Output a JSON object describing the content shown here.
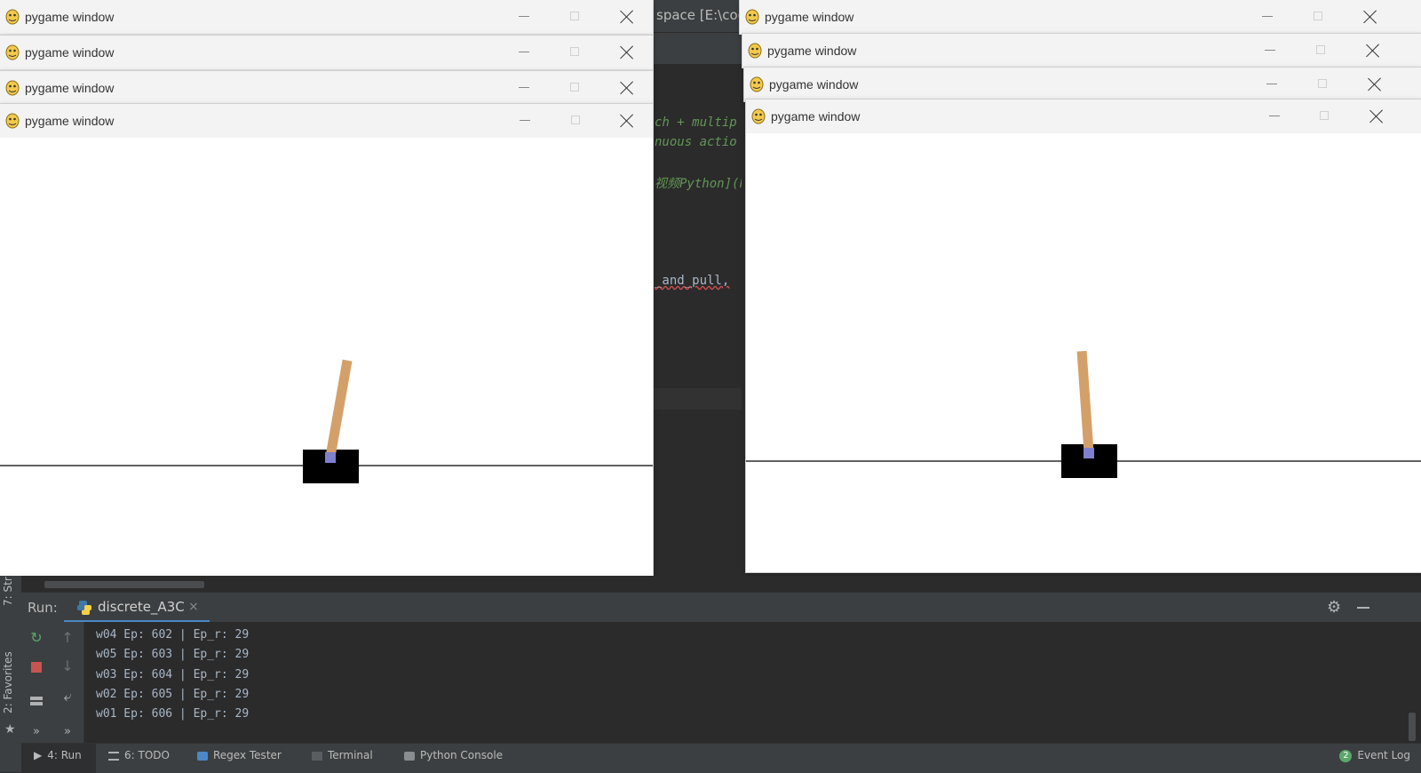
{
  "ide": {
    "project_title": "space [E:\\code",
    "code_lines": [
      {
        "text": "ch + multip",
        "style": "comment"
      },
      {
        "text": "nuous actio",
        "style": "comment"
      },
      {
        "text": "视频Python](h",
        "style": "comment"
      },
      {
        "text": "_and_pull,",
        "style": "plain"
      }
    ]
  },
  "pygame_windows": [
    {
      "title": "pygame window"
    },
    {
      "title": "pygame window"
    },
    {
      "title": "pygame window"
    },
    {
      "title": "pygame window"
    },
    {
      "title": "pygame window"
    },
    {
      "title": "pygame window"
    },
    {
      "title": "pygame window"
    },
    {
      "title": "pygame window"
    }
  ],
  "cartpole": [
    {
      "pole_angle_deg": 10
    },
    {
      "pole_angle_deg": -4
    }
  ],
  "side_tabs": {
    "structure": "7: Str",
    "favorites": "2: Favorites"
  },
  "run": {
    "label": "Run:",
    "tab_name": "discrete_A3C",
    "tab_close": "×",
    "console_lines": [
      "w04 Ep: 602 | Ep_r: 29",
      "w05 Ep: 603 | Ep_r: 29",
      "w03 Ep: 604 | Ep_r: 29",
      "w02 Ep: 605 | Ep_r: 29",
      "w01 Ep: 606 | Ep_r: 29"
    ]
  },
  "bottom_bar": {
    "items": [
      "4: Run",
      "6: TODO",
      "Regex Tester",
      "Terminal",
      "Python Console"
    ],
    "event_count": "2",
    "event_log": "Event Log"
  },
  "colors": {
    "pole": "#d4a06a",
    "axle": "#8080d0",
    "cart": "#000000",
    "accent": "#4a88c7",
    "comment": "#629755"
  }
}
